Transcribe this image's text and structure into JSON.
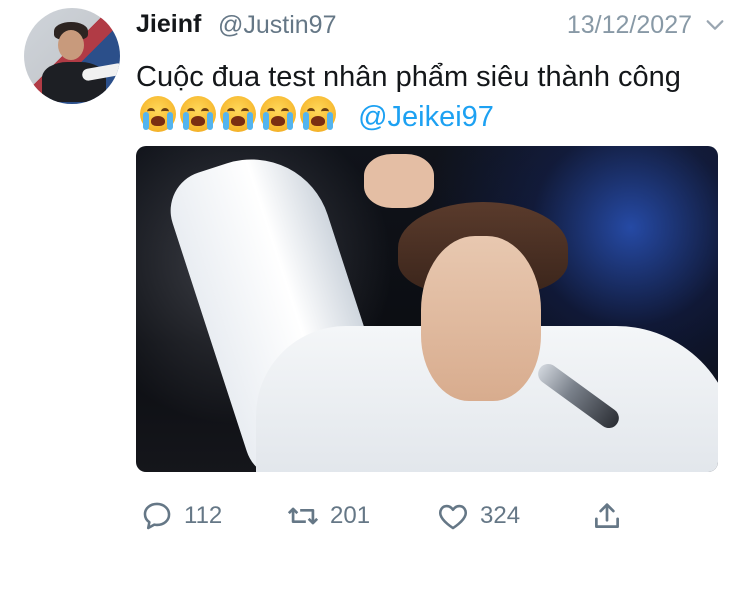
{
  "tweet": {
    "display_name": "Jieinf",
    "handle": "@Justin97",
    "date": "13/12/2027",
    "text": "Cuộc đua test nhân phẩm siêu thành công",
    "mention": "@Jeikei97",
    "emoji": "loudly-crying-face",
    "emoji_count": 5
  },
  "actions": {
    "reply_count": "112",
    "retweet_count": "201",
    "like_count": "324"
  },
  "icons": {
    "reply": "speech-bubble-icon",
    "retweet": "retweet-arrows-icon",
    "like": "heart-icon",
    "share": "share-upload-icon",
    "menu": "chevron-down-icon"
  },
  "colors": {
    "link": "#1da1f2",
    "secondary_text": "#657786",
    "primary_text": "#14171a"
  }
}
